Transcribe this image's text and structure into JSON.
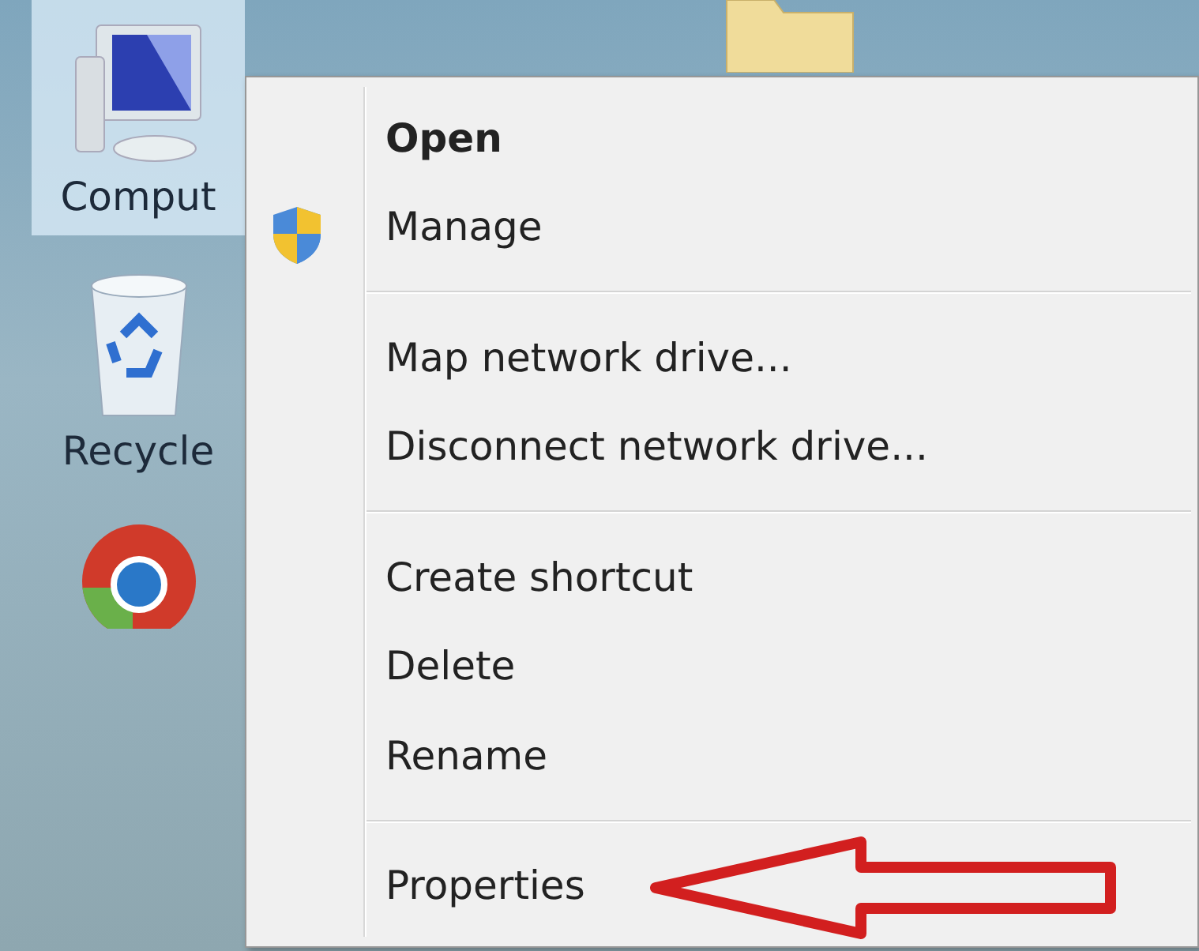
{
  "desktop": {
    "icons": [
      {
        "kind": "computer",
        "label": "Comput",
        "selected": true
      },
      {
        "kind": "recycle-bin",
        "label": "Recycle",
        "selected": false
      },
      {
        "kind": "browser",
        "selected": false
      }
    ]
  },
  "context_menu": {
    "items": [
      {
        "kind": "item",
        "label": "Open",
        "default": true
      },
      {
        "kind": "shielded_item",
        "label": "Manage",
        "default": false
      },
      {
        "kind": "separator"
      },
      {
        "kind": "item",
        "label": "Map network drive...",
        "default": false
      },
      {
        "kind": "item",
        "label": "Disconnect network drive...",
        "default": false
      },
      {
        "kind": "separator"
      },
      {
        "kind": "item",
        "label": "Create shortcut",
        "default": false
      },
      {
        "kind": "item",
        "label": "Delete",
        "default": false
      },
      {
        "kind": "item",
        "label": "Rename",
        "default": false
      },
      {
        "kind": "separator"
      },
      {
        "kind": "item",
        "label": "Properties",
        "default": false,
        "pointed": true
      }
    ]
  }
}
